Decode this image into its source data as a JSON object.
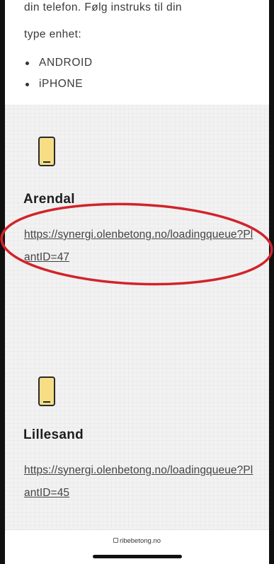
{
  "intro": {
    "line1": "din telefon. Følg instruks til din",
    "line2": "type enhet:",
    "devices": [
      "ANDROID",
      "iPHONE"
    ]
  },
  "sites": [
    {
      "name": "Arendal",
      "link": "https://synergi.olenbetong.no/loadingqueue?PlantID=47",
      "highlighted": true
    },
    {
      "name": "Lillesand",
      "link": "https://synergi.olenbetong.no/loadingqueue?PlantID=45",
      "highlighted": false
    }
  ],
  "browser": {
    "domain": "ribebetong.no"
  },
  "colors": {
    "highlight_circle": "#d2232a",
    "phone_icon_fill": "#f7dd85"
  }
}
